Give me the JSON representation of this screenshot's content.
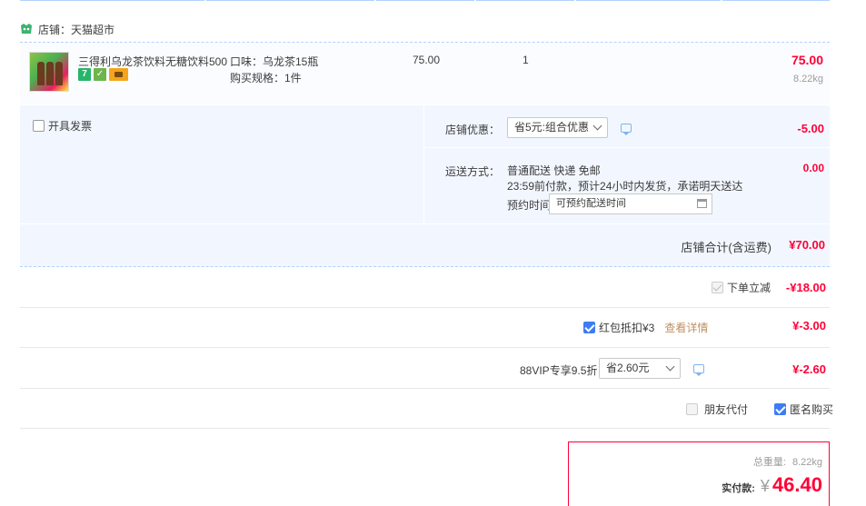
{
  "shop": {
    "label": "店铺：天猫超市"
  },
  "item": {
    "title": "三得利乌龙茶饮料无糖饮料500...",
    "badge7": "7",
    "attr_flavor": "口味：乌龙茶15瓶",
    "attr_spec": "购买规格：1件",
    "price": "75.00",
    "qty": "1",
    "subtotal": "75.00",
    "weight": "8.22kg"
  },
  "invoice": {
    "label": "开具发票"
  },
  "discount": {
    "label": "店铺优惠：",
    "selected": "省5元:组合优惠",
    "amount": "-5.00"
  },
  "shipping": {
    "label": "运送方式：",
    "method": "普通配送 快递 免邮",
    "note": "23:59前付款，预计24小时内发货，承诺明天送达",
    "amount": "0.00",
    "reserve_label": "预约时间",
    "reserve_placeholder": "可预约配送时间"
  },
  "shop_total": {
    "label": "店铺合计(含运费)",
    "amount": "¥70.00"
  },
  "instant": {
    "label": "下单立减",
    "amount": "-¥18.00"
  },
  "redpacket": {
    "label": "红包抵扣¥3",
    "link": "查看详情",
    "amount": "¥-3.00"
  },
  "vip": {
    "label": "88VIP专享9.5折",
    "selected": "省2.60元",
    "amount": "¥-2.60"
  },
  "friend_pay": {
    "label": "朋友代付"
  },
  "anonymous": {
    "label": "匿名购买"
  },
  "summary": {
    "weight_label": "总重量:",
    "weight_value": "8.22kg",
    "pay_label": "实付款:",
    "currency": "¥",
    "total": "46.40"
  },
  "colors": {
    "accent": "#ff0036",
    "panel": "#f2f7ff",
    "checkbox": "#3c7cf6"
  }
}
